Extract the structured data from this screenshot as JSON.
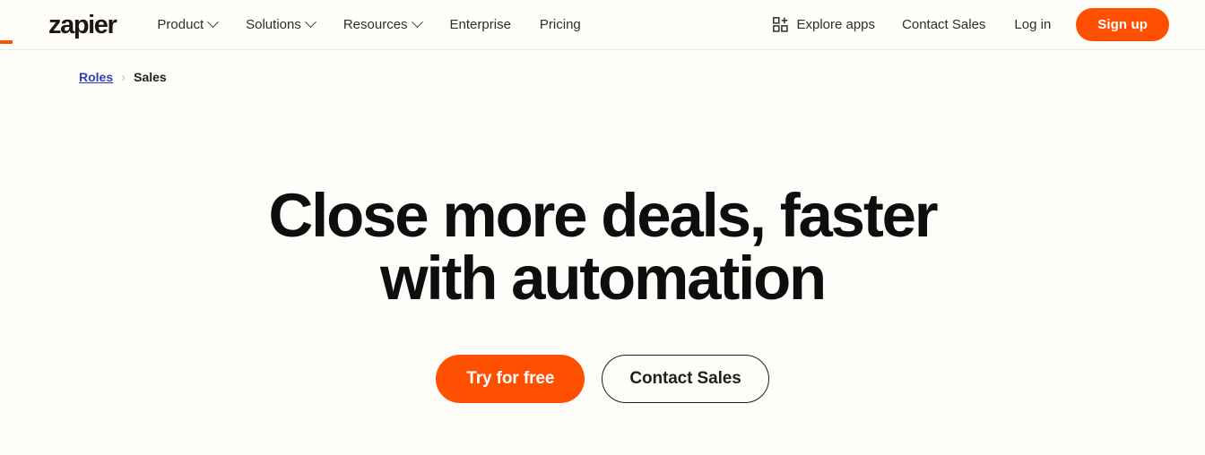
{
  "theme": {
    "background": "#FFFDF9",
    "accent": "#FF4F00",
    "text": "#1F1F1F",
    "link": "#2F3FB5",
    "border": "#EDE9E3"
  },
  "navbar": {
    "logo": {
      "wordmark": "zapier",
      "icon_name": "zapier-logo"
    },
    "links": [
      {
        "label": "Product",
        "has_dropdown": true
      },
      {
        "label": "Solutions",
        "has_dropdown": true
      },
      {
        "label": "Resources",
        "has_dropdown": true
      },
      {
        "label": "Enterprise",
        "has_dropdown": false
      },
      {
        "label": "Pricing",
        "has_dropdown": false
      }
    ],
    "explore_apps": {
      "label": "Explore apps",
      "icon_name": "grid-plus-icon"
    },
    "contact_sales": "Contact Sales",
    "log_in": "Log in",
    "sign_up": "Sign up"
  },
  "breadcrumb": {
    "parent": "Roles",
    "separator": "›",
    "current": "Sales"
  },
  "hero": {
    "title": "Close more deals, faster with automation",
    "primary_cta": "Try for free",
    "secondary_cta": "Contact Sales"
  }
}
